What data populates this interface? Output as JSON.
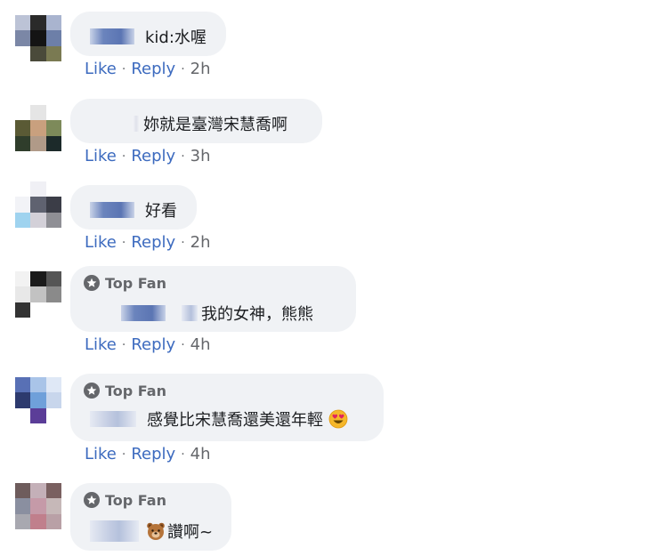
{
  "comments": [
    {
      "text": "kid:水喔",
      "like": "Like",
      "reply": "Reply",
      "time": "2h"
    },
    {
      "text": "妳就是臺灣宋慧喬啊",
      "like": "Like",
      "reply": "Reply",
      "time": "3h"
    },
    {
      "text": "好看",
      "like": "Like",
      "reply": "Reply",
      "time": "2h"
    },
    {
      "badge": "Top Fan",
      "text": "我的女神，熊熊",
      "like": "Like",
      "reply": "Reply",
      "time": "4h"
    },
    {
      "badge": "Top Fan",
      "text": "感覺比宋慧喬還美還年輕",
      "emoji": "heart-eyes-emoji",
      "like": "Like",
      "reply": "Reply",
      "time": "4h"
    },
    {
      "badge": "Top Fan",
      "emoji": "bear-emoji",
      "text": "讚啊~"
    }
  ],
  "separator": "·",
  "colors": {
    "link": "#3d6bbf",
    "meta": "#65676b",
    "bubble": "#f0f2f5"
  }
}
